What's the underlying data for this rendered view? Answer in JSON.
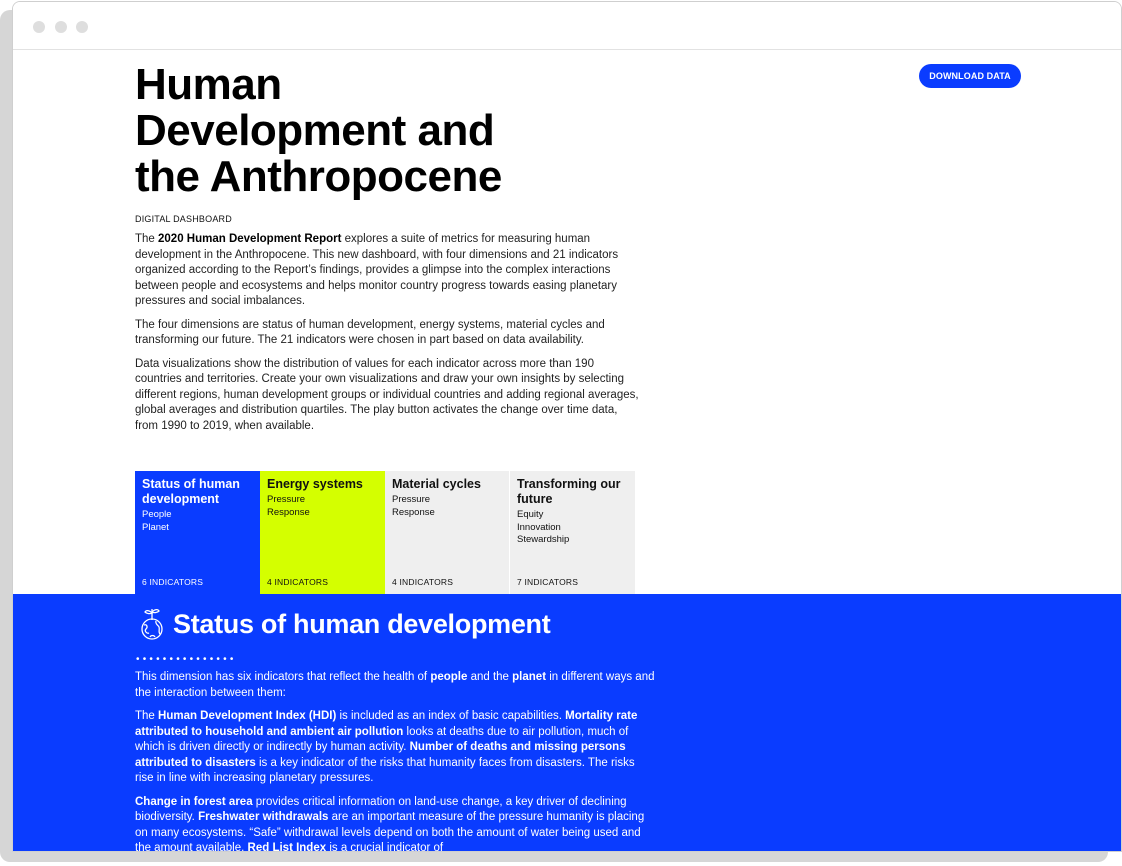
{
  "header": {
    "download_label": "DOWNLOAD DATA"
  },
  "intro": {
    "title": "Human Development and the Anthropocene",
    "eyebrow": "DIGITAL DASHBOARD",
    "p1_bold": "2020 Human Development Report",
    "p1_pre": "The ",
    "p1_post": " explores a suite of metrics for measuring human development in the Anthropocene. This new dashboard, with four dimensions and 21 indicators organized according to the Report’s findings, provides a glimpse into the complex interactions between people and ecosystems and helps monitor country progress towards easing planetary pressures and social imbalances.",
    "p2": "The four dimensions are status of human development, energy systems, material cycles and transforming our future. The 21 indicators were chosen in part based on data availability.",
    "p3": "Data visualizations show the distribution of values for each indicator across more than 190 countries and territories. Create your own visualizations and draw your own insights by selecting different regions, human development groups or individual countries and adding regional averages, global averages and distribution quartiles. The play button activates the change over time data, from 1990 to 2019, when available."
  },
  "dimensions": [
    {
      "title": "Status of human development",
      "subs": [
        "People",
        "Planet"
      ],
      "count": "6 INDICATORS",
      "color": "#0a3cff"
    },
    {
      "title": "Energy systems",
      "subs": [
        "Pressure",
        "Response"
      ],
      "count": "4 INDICATORS",
      "color": "#d4ff00"
    },
    {
      "title": "Material cycles",
      "subs": [
        "Pressure",
        "Response"
      ],
      "count": "4 INDICATORS",
      "color": "#efefef"
    },
    {
      "title": "Transforming our future",
      "subs": [
        "Equity",
        "Innovation",
        "Stewardship"
      ],
      "count": "7 INDICATORS",
      "color": "#efefef"
    }
  ],
  "status_section": {
    "title": "Status of human development",
    "dots": "•••••••••••••••",
    "icon": "globe-plant-icon",
    "p1": {
      "a": "This dimension has six indicators that reflect the health of ",
      "b1": "people",
      "c": " and the ",
      "b2": "planet",
      "d": " in different ways and the interaction between them:"
    },
    "p2": {
      "a": "The ",
      "b1": "Human Development Index (HDI)",
      "c": " is included as an index of basic capabilities. ",
      "b2": "Mortality rate attributed to household and ambient air pollution",
      "d": " looks at deaths due to air pollution, much of which is driven directly or indirectly by human activity. ",
      "b3": "Number of deaths and missing persons attributed to disasters",
      "e": " is a key indicator of the risks that humanity faces from disasters. The risks rise in line with increasing planetary pressures."
    },
    "p3": {
      "b1": "Change in forest area",
      "a": " provides critical information on land-use change, a key driver of declining biodiversity. ",
      "b2": "Freshwater withdrawals",
      "c": " are an important measure of the pressure humanity is placing on many ecosystems. “Safe” withdrawal levels depend on both the amount of water being used and the amount available. ",
      "b3": "Red List Index",
      "d": " is a crucial indicator of"
    }
  },
  "colors": {
    "accent_blue": "#0a3cff",
    "accent_lime": "#d4ff00",
    "panel_grey": "#efefef"
  }
}
